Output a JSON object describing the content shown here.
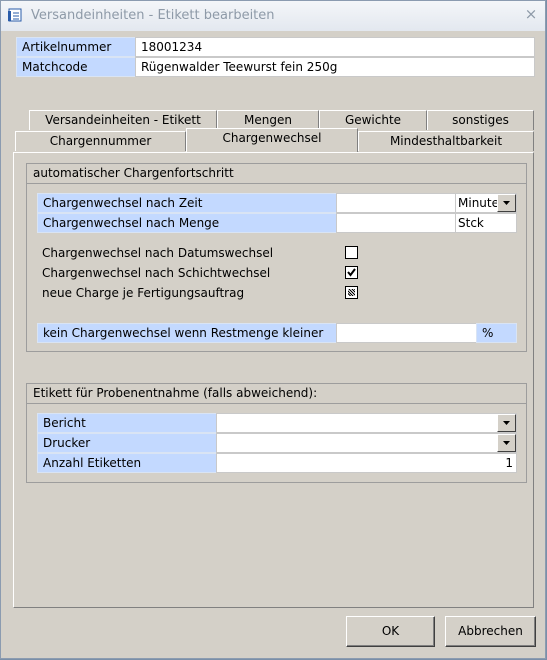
{
  "window": {
    "title": "Versandeinheiten - Etikett bearbeiten",
    "close_glyph": "×"
  },
  "header": {
    "artikelnummer_label": "Artikelnummer",
    "artikelnummer_value": "18001234",
    "matchcode_label": "Matchcode",
    "matchcode_value": "Rügenwalder Teewurst fein 250g"
  },
  "tabs": {
    "back_row": [
      "Versandeinheiten - Etikett",
      "Mengen",
      "Gewichte",
      "sonstiges"
    ],
    "front_row": [
      "Chargennummer",
      "Chargenwechsel",
      "Mindesthaltbarkeit"
    ],
    "active": "Chargenwechsel"
  },
  "auto_group": {
    "title": "automatischer Chargenfortschritt",
    "time_label": "Chargenwechsel nach Zeit",
    "time_value": "",
    "time_unit": "Minute",
    "qty_label": "Chargenwechsel nach Menge",
    "qty_value": "",
    "qty_unit": "Stck",
    "date_change_label": "Chargenwechsel nach Datumswechsel",
    "date_change_checked": false,
    "shift_change_label": "Chargenwechsel nach Schichtwechsel",
    "shift_change_checked": true,
    "new_per_order_label": "neue Charge je Fertigungsauftrag",
    "new_per_order_state": "indeterminate",
    "remaining_label": "kein Chargenwechsel wenn Restmenge kleiner",
    "remaining_value": "",
    "remaining_unit": "%"
  },
  "sample_group": {
    "title": "Etikett für Probenentnahme (falls abweichend):",
    "report_label": "Bericht",
    "report_value": "",
    "printer_label": "Drucker",
    "printer_value": "",
    "count_label": "Anzahl Etiketten",
    "count_value": "1"
  },
  "buttons": {
    "ok": "OK",
    "cancel": "Abbrechen"
  },
  "colors": {
    "label_bg": "#c3d9ff",
    "dialog_bg": "#d4d0c8",
    "title_text": "#8e9aa8"
  },
  "icons": [
    "app-icon",
    "close-icon",
    "dropdown-arrow-icon",
    "checkmark-icon"
  ]
}
